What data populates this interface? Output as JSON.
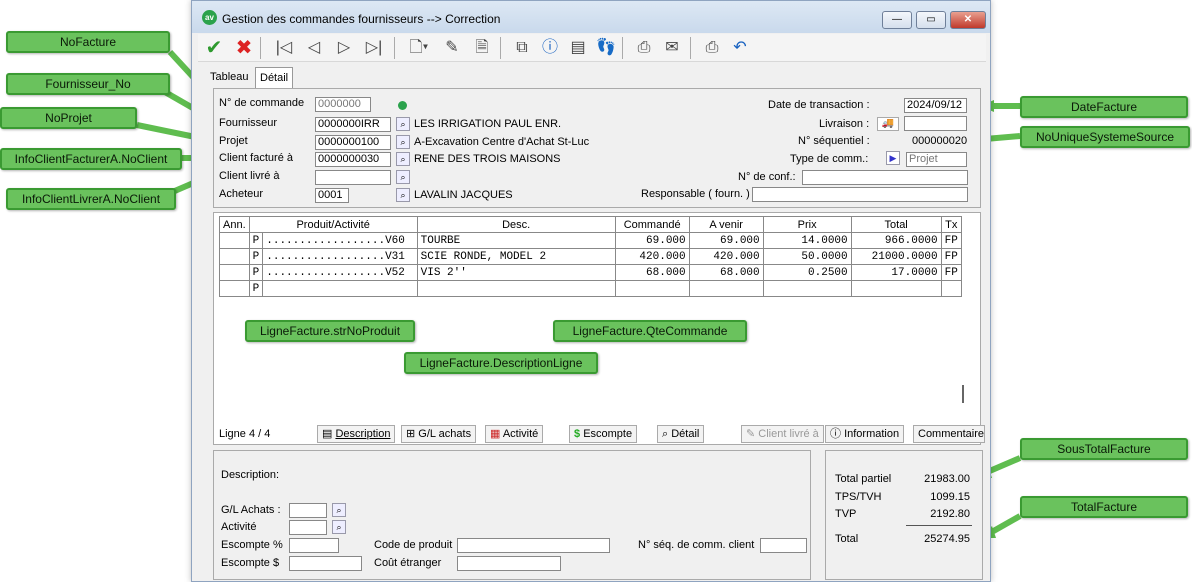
{
  "window": {
    "title": "Gestion des commandes fournisseurs  --> Correction",
    "app_icon": "av"
  },
  "tabs": [
    "Tableau",
    "Détail"
  ],
  "header": {
    "no_commande_label": "N° de commande",
    "no_commande": "0000000",
    "fournisseur_label": "Fournisseur",
    "fournisseur_code": "0000000IRR",
    "fournisseur_name": "LES IRRIGATION PAUL ENR.",
    "projet_label": "Projet",
    "projet_code": "0000000100",
    "projet_name": "A-Excavation Centre d'Achat St-Luc",
    "client_facture_label": "Client facturé à",
    "client_facture_code": "0000000030",
    "client_facture_name": "RENE DES TROIS MAISONS",
    "client_livre_label": "Client livré à",
    "client_livre_code": "",
    "acheteur_label": "Acheteur",
    "acheteur_code": "0001",
    "acheteur_name": "LAVALIN JACQUES",
    "date_label": "Date de transaction :",
    "date": "2024/09/12",
    "livraison_label": "Livraison :",
    "livraison": "",
    "seq_label": "N° séquentiel :",
    "seq": "000000020",
    "type_label": "Type de comm.:",
    "type": "Projet",
    "conf_label": "N° de conf.:",
    "conf": "",
    "resp_label": "Responsable ( fourn. )",
    "resp": ""
  },
  "grid": {
    "columns": [
      "Ann.",
      "Produit/Activité",
      "Desc.",
      "Commandé",
      "A venir",
      "Prix",
      "Total",
      "Tx"
    ],
    "rows": [
      {
        "ann": "",
        "type": "P",
        "produit": "..................V60",
        "desc": "TOURBE",
        "commande": "69.000",
        "avenir": "69.000",
        "prix": "14.0000",
        "total": "966.0000",
        "tx": "FP"
      },
      {
        "ann": "",
        "type": "P",
        "produit": "..................V31",
        "desc": "SCIE RONDE, MODEL 2",
        "commande": "420.000",
        "avenir": "420.000",
        "prix": "50.0000",
        "total": "21000.0000",
        "tx": "FP"
      },
      {
        "ann": "",
        "type": "P",
        "produit": "..................V52",
        "desc": "VIS 2''",
        "commande": "68.000",
        "avenir": "68.000",
        "prix": "0.2500",
        "total": "17.0000",
        "tx": "FP"
      },
      {
        "ann": "",
        "type": "P",
        "produit": "",
        "desc": "",
        "commande": "",
        "avenir": "",
        "prix": "",
        "total": "",
        "tx": ""
      }
    ]
  },
  "actions": {
    "ligne": "Ligne  4 / 4",
    "description": "Description",
    "gl": "G/L achats",
    "activite": "Activité",
    "escompte": "Escompte",
    "detail": "Détail",
    "client_livre": "Client livré à",
    "information": "Information",
    "commentaire": "Commentaire"
  },
  "bottom": {
    "description_label": "Description:",
    "gl_label": "G/L Achats :",
    "activite_label": "Activité",
    "escompte_pct_label": "Escompte %",
    "escompte_amt_label": "Escompte $",
    "code_produit_label": "Code de produit",
    "cout_label": "Coût étranger",
    "seq_client_label": "N° séq. de comm. client"
  },
  "totals": {
    "partiel_label": "Total partiel",
    "partiel": "21983.00",
    "tps_label": "TPS/TVH",
    "tps": "1099.15",
    "tvp_label": "TVP",
    "tvp": "2192.80",
    "total_label": "Total",
    "total": "25274.95"
  },
  "callouts": {
    "nofacture": "NoFacture",
    "fournisseur": "Fournisseur_No",
    "noprojet": "NoProjet",
    "facturer": "InfoClientFacturerA.NoClient",
    "livrer": "InfoClientLivrerA.NoClient",
    "datefacture": "DateFacture",
    "nounique": "NoUniqueSystemeSource",
    "strnoproduit": "LigneFacture.strNoProduit",
    "descligne": "LigneFacture.DescriptionLigne",
    "qtecommande": "LigneFacture.QteCommande",
    "soustotal": "SousTotalFacture",
    "totalfacture": "TotalFacture"
  },
  "colors": {
    "callout": "#6ac25d",
    "accent": "#2ba24c"
  }
}
